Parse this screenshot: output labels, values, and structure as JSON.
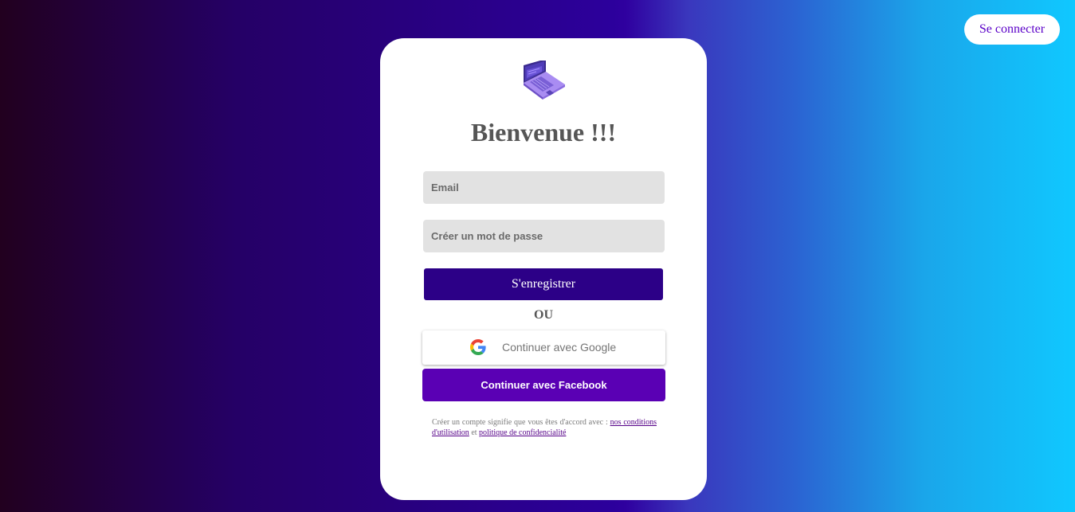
{
  "header": {
    "login_label": "Se connecter"
  },
  "card": {
    "logo_icon": "laptop-icon",
    "title": "Bienvenue !!!",
    "email_placeholder": "Email",
    "password_placeholder": "Créer un mot de passe",
    "register_label": "S'enregistrer",
    "or_label": "OU",
    "google_icon": "google-icon",
    "google_label": "Continuer avec Google",
    "facebook_label": "Continuer avec Facebook",
    "terms": {
      "prefix": "Créer un compte signifie que vous êtes d'accord avec : ",
      "conditions_link": "nos conditions d'utilisation",
      "middle": " et ",
      "privacy_link": "politique de confidencialité"
    }
  },
  "colors": {
    "primary": "#2c0087",
    "facebook": "#5a00b4",
    "login_text": "#5a00c8",
    "link": "#550088"
  }
}
